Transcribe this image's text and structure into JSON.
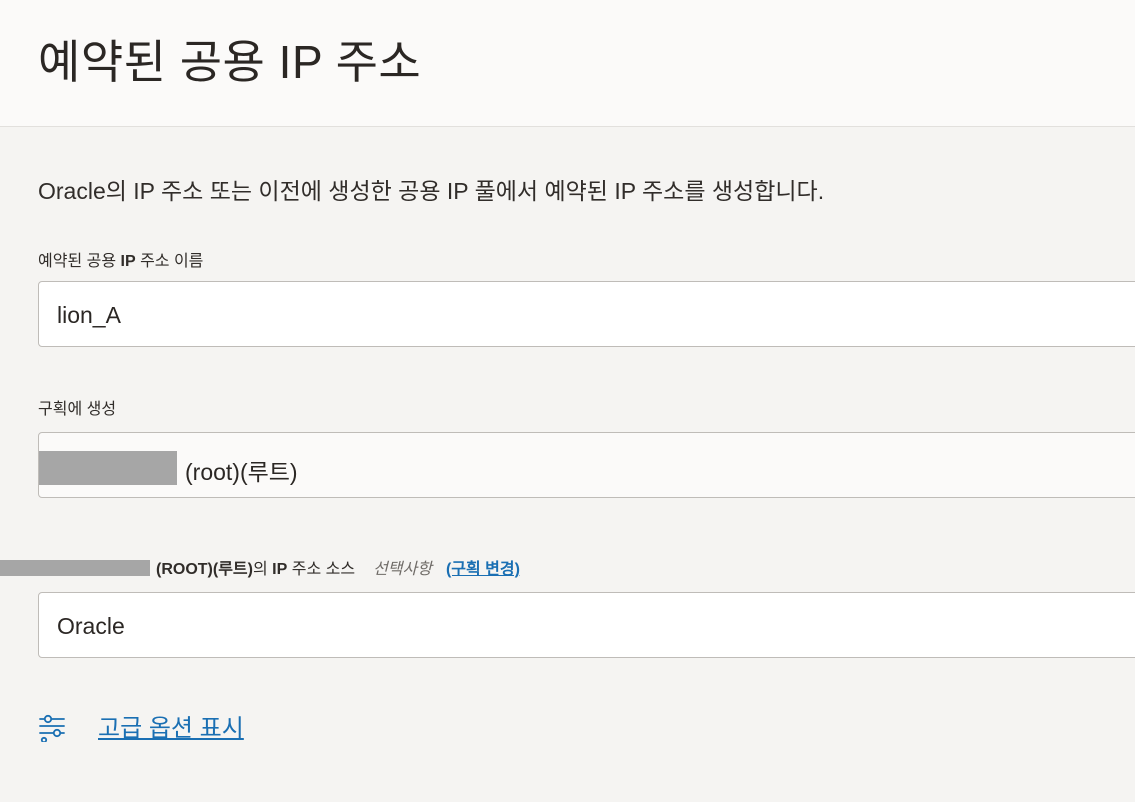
{
  "header": {
    "title": "예약된 공용 IP 주소"
  },
  "intro_text": "Oracle의 IP 주소 또는 이전에 생성한 공용 IP 풀에서 예약된 IP 주소를 생성합니다.",
  "name_field": {
    "label_prefix": "예약된 공용 ",
    "label_ip": "IP",
    "label_suffix": " 주소 이름",
    "value": "lion_A"
  },
  "compartment_field": {
    "label": "구획에 생성",
    "value": "(root)(루트)"
  },
  "ip_source_field": {
    "label_bold": "(ROOT)(루트)",
    "label_mid": "의 ",
    "label_ip": "IP",
    "label_suffix": " 주소 소스",
    "optional": "선택사항",
    "change_link": "(구획 변경)",
    "value": "Oracle"
  },
  "advanced": {
    "label": "고급 옵션 표시",
    "icon": "sliders-icon"
  },
  "colors": {
    "accent_link": "#1a6fb3",
    "redaction": "#a6a6a6"
  }
}
